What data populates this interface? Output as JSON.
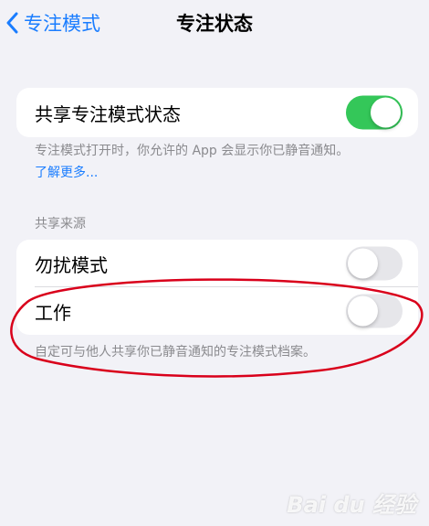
{
  "nav": {
    "back_label": "专注模式",
    "title": "专注状态"
  },
  "share_group": {
    "row_label": "共享专注模式状态",
    "toggle_on": true,
    "footnote": "专注模式打开时，你允许的 App 会显示你已静音通知。",
    "learn_more": "了解更多..."
  },
  "sources": {
    "header": "共享来源",
    "items": [
      {
        "label": "勿扰模式",
        "toggle_on": false
      },
      {
        "label": "工作",
        "toggle_on": false
      }
    ],
    "footnote": "自定可与他人共享你已静音通知的专注模式档案。"
  },
  "colors": {
    "accent_blue": "#1a7dff",
    "toggle_on_green": "#34c759",
    "annotation_red": "#d9001b"
  },
  "watermark_text": "Bai du 经验"
}
